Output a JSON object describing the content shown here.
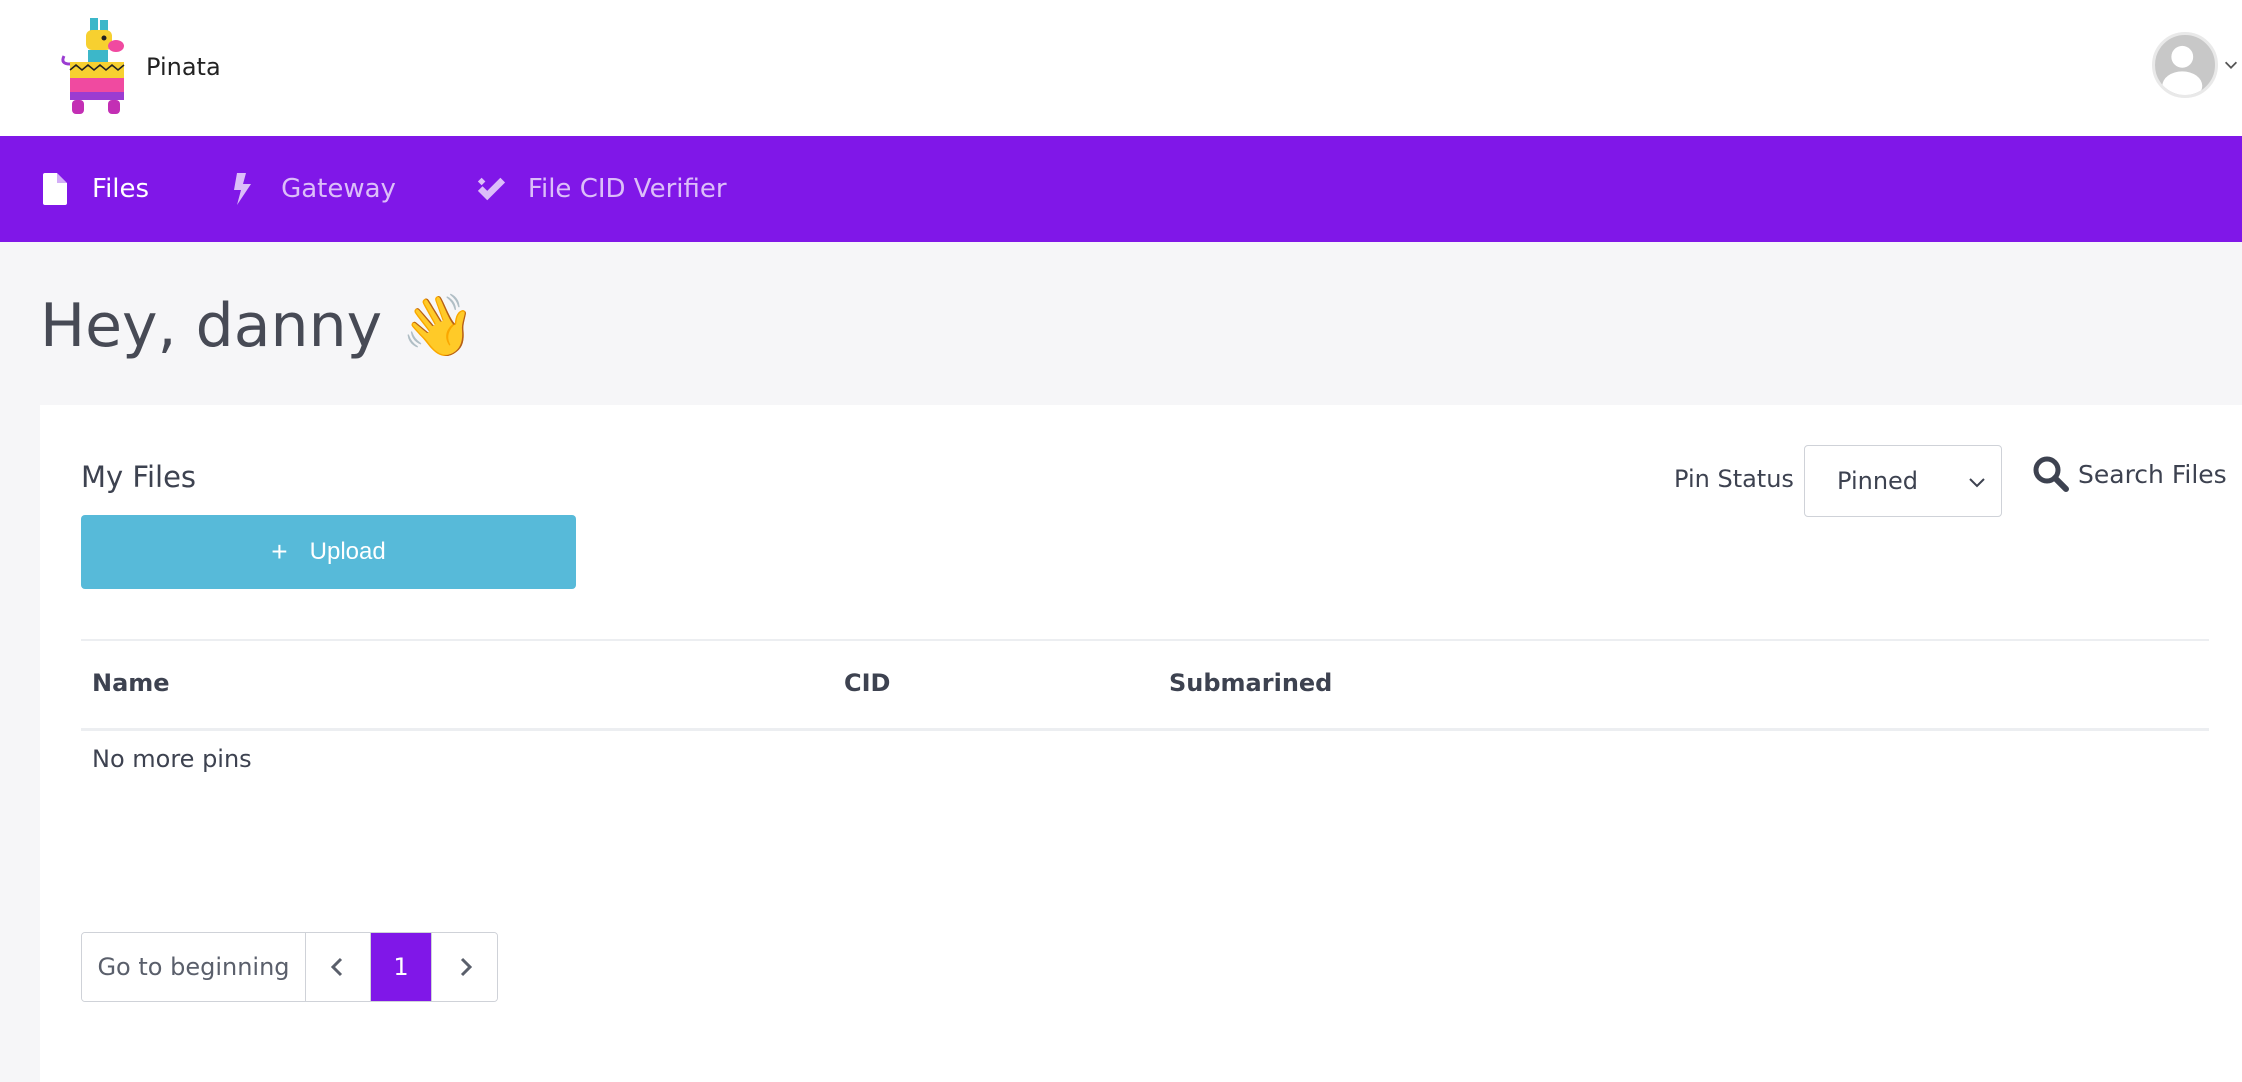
{
  "header": {
    "brand_name": "Pinata",
    "logo_icon": "pinata-llama-logo",
    "avatar_icon": "user-avatar-icon"
  },
  "nav": {
    "items": [
      {
        "label": "Files",
        "icon": "file-icon",
        "active": true
      },
      {
        "label": "Gateway",
        "icon": "lightning-bolt-icon",
        "active": false
      },
      {
        "label": "File CID Verifier",
        "icon": "double-check-icon",
        "active": false
      }
    ]
  },
  "greeting": "Hey, danny 👋",
  "files": {
    "title": "My Files",
    "upload_label": "Upload",
    "pin_status_label": "Pin Status",
    "pin_status_value": "Pinned",
    "search_label": "Search Files",
    "columns": [
      "Name",
      "CID",
      "Submarined"
    ],
    "empty_message": "No more pins"
  },
  "pagination": {
    "begin_label": "Go to beginning",
    "current_page": "1"
  },
  "colors": {
    "accent": "#8017e8",
    "upload": "#57bad9"
  }
}
